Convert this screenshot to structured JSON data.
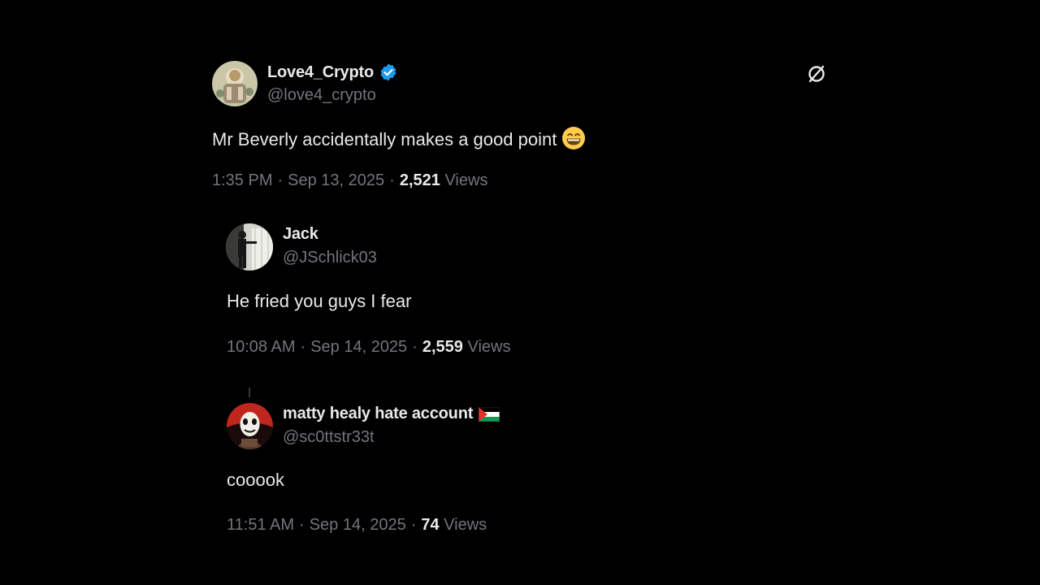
{
  "tweets": [
    {
      "display_name": "Love4_Crypto",
      "handle": "@love4_crypto",
      "verified": true,
      "text": "Mr Beverly accidentally makes a good point",
      "emoji": "grinning-face",
      "time": "1:35 PM",
      "date": "Sep 13, 2025",
      "views_count": "2,521",
      "views_label": "Views"
    },
    {
      "display_name": "Jack",
      "handle": "@JSchlick03",
      "text": "He fried you guys I fear",
      "time": "10:08 AM",
      "date": "Sep 14, 2025",
      "views_count": "2,559",
      "views_label": "Views"
    },
    {
      "display_name": "matty healy hate account",
      "handle": "@sc0ttstr33t",
      "flag": "palestine-flag",
      "text": "cooook",
      "time": "11:51 AM",
      "date": "Sep 14, 2025",
      "views_count": "74",
      "views_label": "Views"
    }
  ],
  "separator": "·",
  "colors": {
    "background": "#000000",
    "text": "#e7e9ea",
    "muted": "#71767b",
    "verified": "#1d9bf0"
  }
}
